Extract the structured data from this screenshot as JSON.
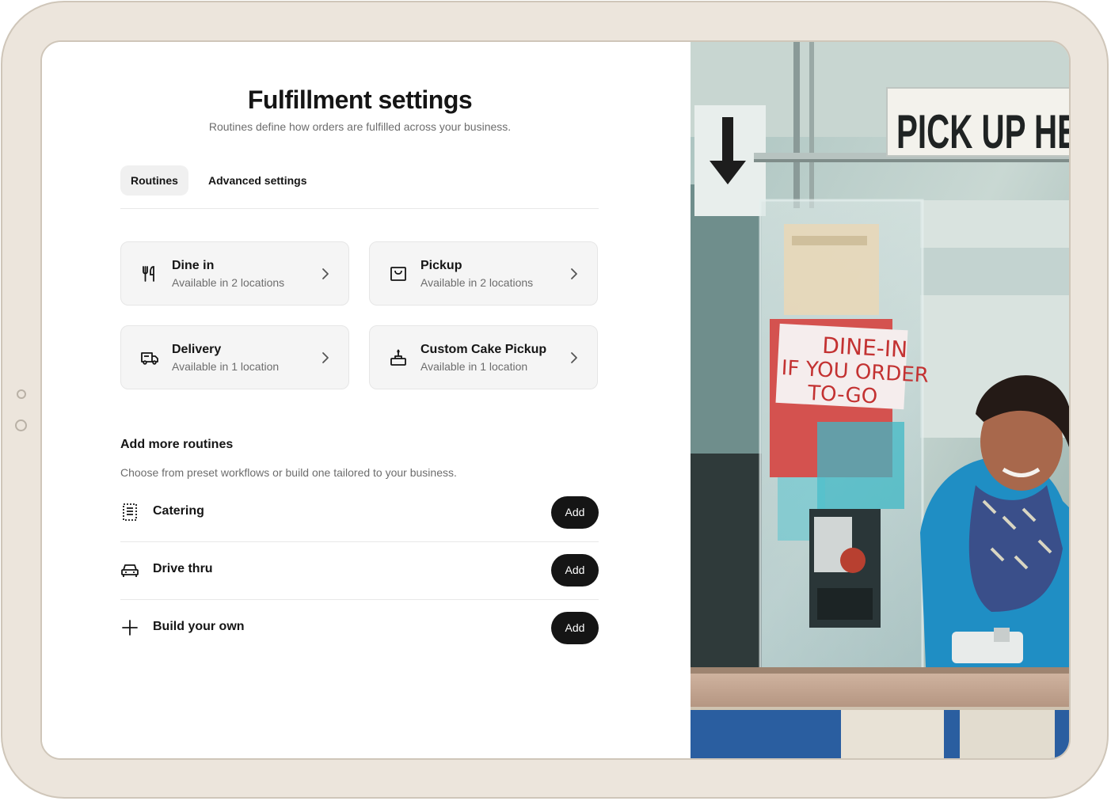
{
  "header": {
    "title": "Fulfillment settings",
    "subtitle": "Routines define how orders are fulfilled across your business."
  },
  "tabs": [
    {
      "label": "Routines",
      "active": true
    },
    {
      "label": "Advanced settings",
      "active": false
    }
  ],
  "routines": [
    {
      "title": "Dine in",
      "subtitle": "Available in 2 locations",
      "icon": "utensils-icon"
    },
    {
      "title": "Pickup",
      "subtitle": "Available in 2 locations",
      "icon": "bag-icon"
    },
    {
      "title": "Delivery",
      "subtitle": "Available in 1 location",
      "icon": "truck-icon"
    },
    {
      "title": "Custom Cake Pickup",
      "subtitle": "Available in 1 location",
      "icon": "cake-icon"
    }
  ],
  "add_more": {
    "title": "Add more routines",
    "subtitle": "Choose from preset workflows or build one tailored to your business.",
    "items": [
      {
        "label": "Catering",
        "button": "Add",
        "icon": "receipt-icon"
      },
      {
        "label": "Drive thru",
        "button": "Add",
        "icon": "car-icon"
      },
      {
        "label": "Build your own",
        "button": "Add",
        "icon": "plus-icon"
      }
    ]
  },
  "photo": {
    "sign_text": "PICK UP HE",
    "note_lines": [
      "DINE-IN",
      "IF YOU ORDER",
      "TO-GO"
    ]
  },
  "colors": {
    "device_frame": "#ece5dc",
    "card_bg": "#f5f5f5",
    "button_bg": "#151515",
    "text_primary": "#151515",
    "text_secondary": "#6d6d6d"
  }
}
